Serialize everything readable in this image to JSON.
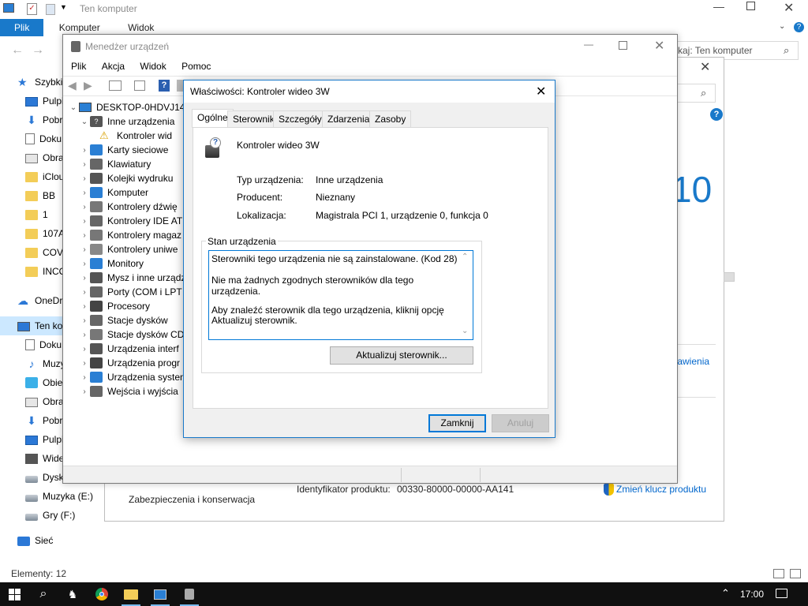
{
  "explorer": {
    "title": "Ten komputer",
    "ribbon_tabs": [
      "Plik",
      "Komputer",
      "Widok"
    ],
    "search_placeholder": "kaj: Ten komputer",
    "nav_items": [
      {
        "label": "Szybki",
        "icon": "star-icon"
      },
      {
        "label": "Pulpi",
        "icon": "desktop-icon"
      },
      {
        "label": "Pobr",
        "icon": "download-icon"
      },
      {
        "label": "Doku",
        "icon": "document-icon"
      },
      {
        "label": "Obra",
        "icon": "pictures-icon"
      },
      {
        "label": "iClou",
        "icon": "folder-icon"
      },
      {
        "label": "BB",
        "icon": "folder-icon"
      },
      {
        "label": "1",
        "icon": "folder-icon"
      },
      {
        "label": "107A",
        "icon": "folder-icon"
      },
      {
        "label": "COVI",
        "icon": "folder-icon"
      },
      {
        "label": "INCO",
        "icon": "folder-icon"
      },
      {
        "label": "OneDr",
        "icon": "cloud-icon"
      },
      {
        "label": "Ten ko",
        "icon": "computer-icon"
      },
      {
        "label": "Doku",
        "icon": "document-icon"
      },
      {
        "label": "Muzy",
        "icon": "music-icon"
      },
      {
        "label": "Obie",
        "icon": "cube-icon"
      },
      {
        "label": "Obra",
        "icon": "pictures-icon"
      },
      {
        "label": "Pobr",
        "icon": "download-icon"
      },
      {
        "label": "Pulpi",
        "icon": "desktop-icon"
      },
      {
        "label": "Wide",
        "icon": "video-icon"
      },
      {
        "label": "Dysk",
        "icon": "drive-icon"
      },
      {
        "label": "Muzyka (E:)",
        "icon": "drive-icon"
      },
      {
        "label": "Gry (F:)",
        "icon": "drive-icon"
      },
      {
        "label": "Sieć",
        "icon": "network-icon"
      }
    ],
    "status": "Elementy: 12"
  },
  "sysinfo": {
    "windows_version_fragment": "10",
    "link_settings_fragment": "tawienia",
    "security_label": "Zabezpieczenia i konserwacja",
    "product_id_label": "Identyfikator produktu:",
    "product_id_value": "00330-80000-00000-AA141",
    "change_key_link": "Zmień klucz produktu"
  },
  "devmgr": {
    "title": "Menedżer urządzeń",
    "menu": [
      "Plik",
      "Akcja",
      "Widok",
      "Pomoc"
    ],
    "tree_root": "DESKTOP-0HDVJ14",
    "tree": [
      {
        "label": "Inne urządzenia",
        "expanded": true,
        "level": 1
      },
      {
        "label": "Kontroler wid",
        "level": 2,
        "warning": true
      },
      {
        "label": "Karty sieciowe",
        "level": 1
      },
      {
        "label": "Klawiatury",
        "level": 1
      },
      {
        "label": "Kolejki wydruku",
        "level": 1
      },
      {
        "label": "Komputer",
        "level": 1
      },
      {
        "label": "Kontrolery dźwię",
        "level": 1
      },
      {
        "label": "Kontrolery IDE AT",
        "level": 1
      },
      {
        "label": "Kontrolery magaz",
        "level": 1
      },
      {
        "label": "Kontrolery uniwe",
        "level": 1
      },
      {
        "label": "Monitory",
        "level": 1
      },
      {
        "label": "Mysz i inne urządz",
        "level": 1
      },
      {
        "label": "Porty (COM i LPT",
        "level": 1
      },
      {
        "label": "Procesory",
        "level": 1
      },
      {
        "label": "Stacje dysków",
        "level": 1
      },
      {
        "label": "Stacje dysków CD",
        "level": 1
      },
      {
        "label": "Urządzenia interf",
        "level": 1
      },
      {
        "label": "Urządzenia progr",
        "level": 1
      },
      {
        "label": "Urządzenia systen",
        "level": 1
      },
      {
        "label": "Wejścia i wyjścia",
        "level": 1
      }
    ]
  },
  "props": {
    "title": "Właściwości: Kontroler wideo 3W",
    "tabs": [
      "Ogólne",
      "Sterownik",
      "Szczegóły",
      "Zdarzenia",
      "Zasoby"
    ],
    "device_name": "Kontroler wideo 3W",
    "fields": [
      {
        "label": "Typ urządzenia:",
        "value": "Inne urządzenia"
      },
      {
        "label": "Producent:",
        "value": "Nieznany"
      },
      {
        "label": "Lokalizacja:",
        "value": "Magistrala PCI 1, urządzenie 0, funkcja 0"
      }
    ],
    "status_group": "Stan urządzenia",
    "status_lines": [
      "Sterowniki tego urządzenia nie są zainstalowane. (Kod 28)",
      "Nie ma żadnych zgodnych sterowników dla tego urządzenia.",
      "Aby znaleźć sterownik dla tego urządzenia, kliknij opcję Aktualizuj sterownik."
    ],
    "update_button": "Aktualizuj sterownik...",
    "close_button": "Zamknij",
    "cancel_button": "Anuluj"
  },
  "taskbar": {
    "time": "17:00"
  },
  "colors": {
    "accent": "#1979ca",
    "link": "#0066cc",
    "taskbar": "#101010"
  }
}
